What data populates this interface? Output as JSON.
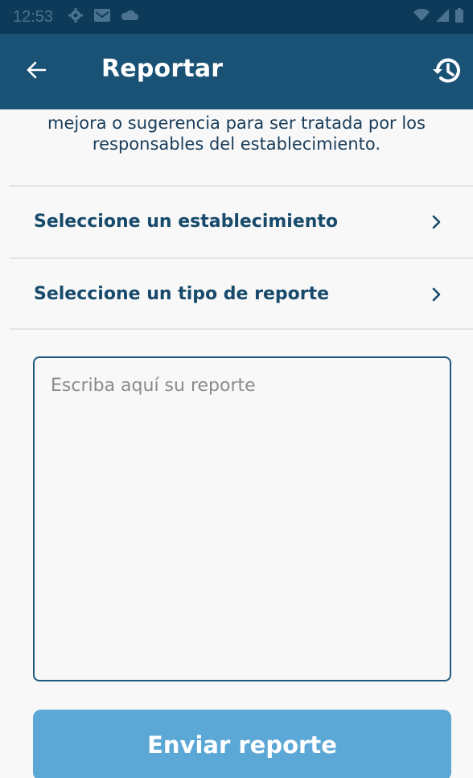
{
  "status_bar": {
    "time": "12:53",
    "left_icons": [
      "settings-icon",
      "gmail-icon",
      "cloud-icon"
    ],
    "right_icons": [
      "wifi-icon",
      "signal-icon",
      "battery-icon"
    ]
  },
  "app_bar": {
    "title": "Reportar",
    "back_icon": "arrow-back-icon",
    "history_icon": "history-icon"
  },
  "description": {
    "line1": "mejora o sugerencia para ser tratada por los",
    "line2": "responsables del establecimiento."
  },
  "selectors": [
    {
      "label": "Seleccione un establecimiento",
      "icon": "chevron-right-icon"
    },
    {
      "label": "Seleccione un tipo de reporte",
      "icon": "chevron-right-icon"
    }
  ],
  "report": {
    "placeholder": "Escriba aquí su reporte",
    "value": ""
  },
  "submit": {
    "label": "Enviar reporte"
  },
  "colors": {
    "status_bar": "#0e3a59",
    "app_bar": "#1a5276",
    "primary_text": "#174a6b",
    "button": "#5ba7d6",
    "background": "#f8f8f8"
  }
}
